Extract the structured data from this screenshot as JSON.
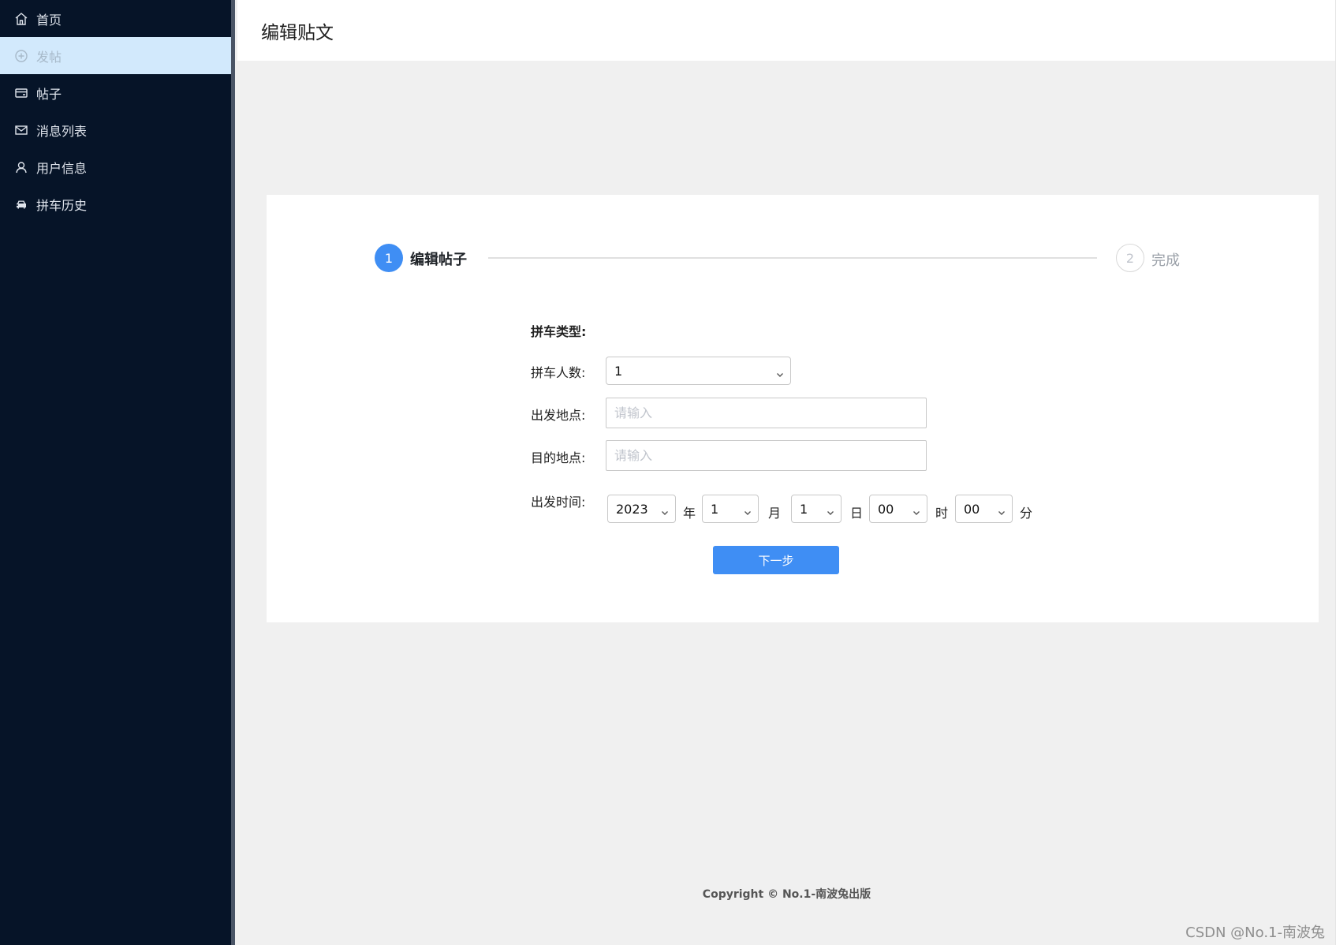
{
  "sidebar": {
    "items": [
      {
        "label": "首页",
        "icon": "home-icon",
        "active": false
      },
      {
        "label": "发帖",
        "icon": "plus-circle-icon",
        "active": true
      },
      {
        "label": "帖子",
        "icon": "wallet-icon",
        "active": false
      },
      {
        "label": "消息列表",
        "icon": "mail-icon",
        "active": false
      },
      {
        "label": "用户信息",
        "icon": "user-icon",
        "active": false
      },
      {
        "label": "拼车历史",
        "icon": "car-icon",
        "active": false
      }
    ]
  },
  "header": {
    "title": "编辑贴文"
  },
  "steps": [
    {
      "number": "1",
      "label": "编辑帖子"
    },
    {
      "number": "2",
      "label": "完成"
    }
  ],
  "form": {
    "type_label": "拼车类型:",
    "count_label": "拼车人数:",
    "count_value": "1",
    "from_label": "出发地点:",
    "from_placeholder": "请输入",
    "to_label": "目的地点:",
    "to_placeholder": "请输入",
    "time_label": "出发时间:",
    "year_value": "2023",
    "year_unit": "年",
    "month_value": "1",
    "month_unit": "月",
    "day_value": "1",
    "day_unit": "日",
    "hour_value": "00",
    "hour_unit": "时",
    "minute_value": "00",
    "minute_unit": "分",
    "next_button": "下一步"
  },
  "footer": {
    "copyright": "Copyright ©  No.1-南波兔出版"
  },
  "watermark": "CSDN @No.1-南波兔",
  "colors": {
    "sidebar_bg": "#061428",
    "accent": "#3f8ef4",
    "active_item_bg": "#d2e9fc"
  }
}
